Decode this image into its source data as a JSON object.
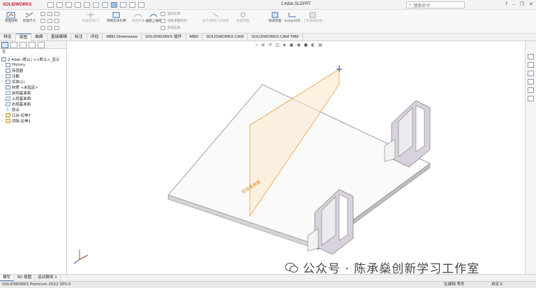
{
  "app": {
    "logo": "SOLIDWORKS",
    "doc_title": "2.4dsb.SLDPRT"
  },
  "search": {
    "placeholder": "搜索命令"
  },
  "ribbon": {
    "sketch": "草图绘制",
    "smart_dim": "智能尺寸",
    "trim": "剪裁实体(T)",
    "convert": "转换实体引用",
    "offset_solid": "等距实体",
    "offset_surface": "曲面上偏移",
    "mirror": "镜向实体",
    "linear_pattern": "线性草图阵列",
    "move": "移动实体",
    "display_delete": "显示/删除几何关系",
    "repair": "修复草图",
    "quick_snap": "快速草图",
    "instant2d": "Instant2D",
    "shaded_sketch": "上色草图轮廓"
  },
  "tabs": [
    "特征",
    "草图",
    "曲面",
    "直接编辑",
    "标注",
    "评估",
    "MBD Dimensions",
    "SOLIDWORKS 插件",
    "MBD",
    "SOLIDWORKS CAM",
    "SOLIDWORKS CAM TBM"
  ],
  "active_tab": "草图",
  "tree": {
    "root": "2.4dsb (默认) <<默认>_显示",
    "items": [
      {
        "label": "History",
        "expand": "›",
        "icon": "folder"
      },
      {
        "label": "传感器",
        "expand": "",
        "icon": "sensor"
      },
      {
        "label": "注解",
        "expand": "›",
        "icon": "annot"
      },
      {
        "label": "实体(1)",
        "expand": "›",
        "icon": "solid"
      },
      {
        "label": "材质 <未指定>",
        "expand": "",
        "icon": "material"
      },
      {
        "label": "前视基准面",
        "expand": "",
        "icon": "plane"
      },
      {
        "label": "上视基准面",
        "expand": "",
        "icon": "plane"
      },
      {
        "label": "右视基准面",
        "expand": "",
        "icon": "plane"
      },
      {
        "label": "原点",
        "expand": "",
        "icon": "origin"
      },
      {
        "label": "凸台-拉伸7",
        "expand": "›",
        "icon": "feat"
      },
      {
        "label": "切除-拉伸1",
        "expand": "›",
        "icon": "feat"
      }
    ]
  },
  "bottom_tabs": [
    "模型",
    "3D 视图",
    "运动算例 1"
  ],
  "active_bottom_tab": "模型",
  "status": {
    "left": "SOLIDWORKS Premium 2022 SP0.0",
    "editing": "在编辑 零件",
    "custom": "自定义"
  },
  "watermark": {
    "text": "公众号 · 陈承燊创新学习工作室"
  },
  "colors": {
    "accent": "#4a7fc0",
    "logo": "#c8102e",
    "plane": "#f0a040",
    "bracket": "#d9d2dc"
  }
}
